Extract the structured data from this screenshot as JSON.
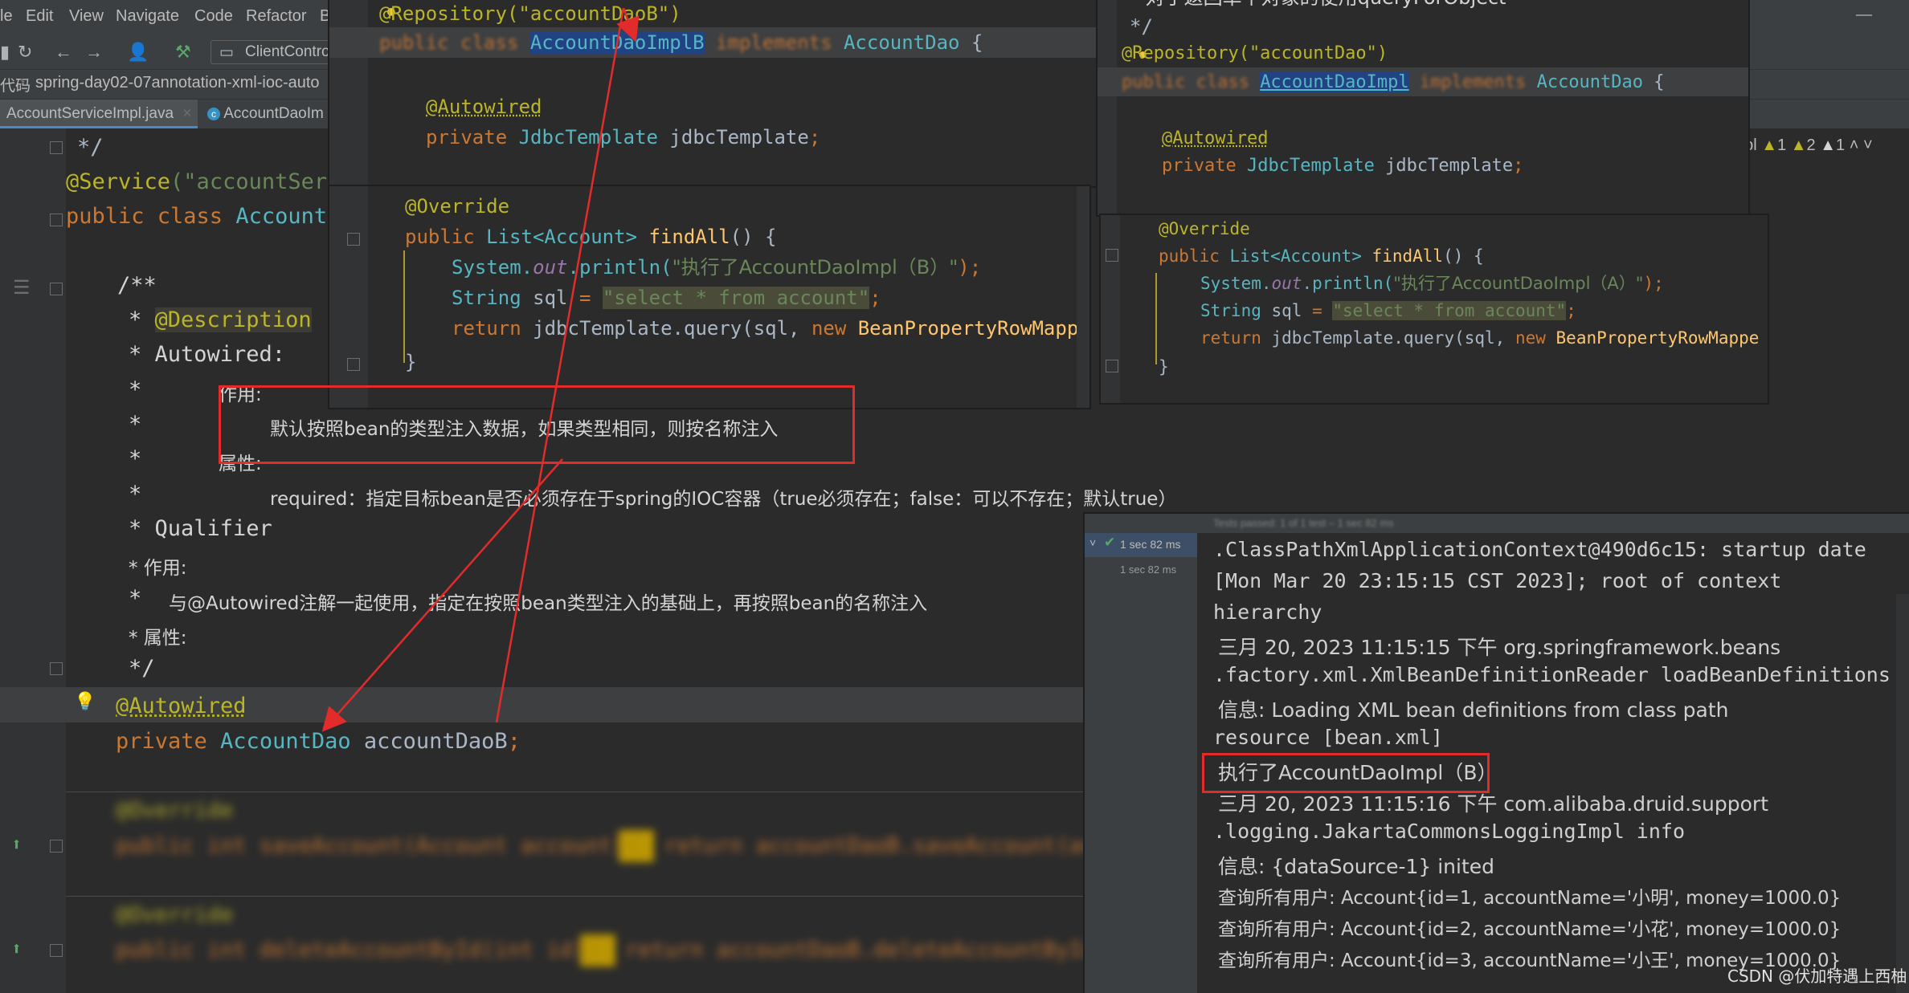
{
  "menu": [
    "le",
    "Edit",
    "View",
    "Navigate",
    "Code",
    "Refactor",
    "B"
  ],
  "toolbar": {
    "run_config": "ClientContro"
  },
  "breadcrumb": {
    "prefix": "代码",
    "project": "spring-day02-07annotation-xml-ioc-auto"
  },
  "tabs": [
    {
      "label": "AccountServiceImpl.java",
      "close": "×"
    },
    {
      "label": "AccountDaoIm"
    }
  ],
  "main_code": {
    "l1": "*/",
    "l2_ann": "@Service",
    "l2_rest": "(\"accountServ",
    "l3_kw": "public class ",
    "l3_cls": "AccountS",
    "doc_open": "/**",
    "doc_desc_star": "* ",
    "doc_desc": "@Description",
    "doc_autowired": "* Autowired:",
    "doc_star": "*",
    "doc_role": "作用:",
    "doc_role_text": "默认按照bean的类型注入数据，如果类型相同，则按名称注入",
    "doc_attr": "属性:",
    "doc_required": "required：指定目标bean是否必须存在于spring的IOC容器（true必须存在；false：可以不存在；默认true）",
    "doc_qualifier": "* Qualifier",
    "doc_q_role": "* 作用:",
    "doc_q_text": "与@Autowired注解一起使用，指定在按照bean类型注入的基础上，再按照bean的名称注入",
    "doc_q_attr": "* 属性:",
    "doc_close": "*/",
    "autowired": "@Autowired",
    "field_kw": "private ",
    "field_type": "AccountDao",
    "field_name": " accountDaoB",
    "field_semi": ";",
    "blur_override1": "@Override",
    "blur_line1": "public int saveAccount(Account account) { return accountDaoB.saveAccount(ac",
    "blur_override2": "@Override",
    "blur_line2": "public int deleteAccountById(int id) { return accountDaoB.deleteAccountById("
  },
  "pane_b": {
    "repo": "@Repository(\"accountDaoB\")",
    "decl_kw": "public class ",
    "decl_cls": "AccountDaoImplB",
    "decl_impl": " implements ",
    "decl_iface": "AccountDao",
    "decl_brace": " {",
    "autowired": "@Autowired",
    "field_kw": "private ",
    "field_type": "JdbcTemplate",
    "field_name": " jdbcTemplate",
    "semi": ";",
    "override": "@Override",
    "m_kw": "public ",
    "m_type": "List<",
    "m_generic": "Account",
    "m_close": "> ",
    "m_name": "findAll",
    "m_rest": "() {",
    "p1": "System.",
    "p_out": "out",
    "p2": ".println(",
    "p_str": "\"执行了AccountDaoImpl（B）\"",
    "p_end": ");",
    "s_type": "String ",
    "s_var": "sql ",
    "s_eq": "= ",
    "s_str": "\"select * from account\"",
    "ret_kw": "return ",
    "ret_rest": "jdbcTemplate.query(sql, ",
    "ret_new": "new ",
    "ret_cls": "BeanPropertyRowMappe",
    "close": "}"
  },
  "pane_a": {
    "top_comment": "* 对于返回单个对象的使用queryForObject",
    "top_close": "*/",
    "repo": "@Repository(\"accountDao\")",
    "decl_kw": "public class ",
    "decl_cls": "AccountDaoImpl",
    "decl_impl": " implements ",
    "decl_iface": "AccountDao",
    "decl_brace": " {",
    "autowired": "@Autowired",
    "field_kw": "private ",
    "field_type": "JdbcTemplate",
    "field_name": " jdbcTemplate",
    "semi": ";",
    "override": "@Override",
    "m_kw": "public ",
    "m_type": "List<",
    "m_generic": "Account",
    "m_close": "> ",
    "m_name": "findAll",
    "m_rest": "() {",
    "p1": "System.",
    "p_out": "out",
    "p2": ".println(",
    "p_str": "\"执行了AccountDaoImpl（A）\"",
    "p_end": ");",
    "s_type": "String ",
    "s_var": "sql ",
    "s_eq": "= ",
    "s_str": "\"select * from account\"",
    "ret_kw": "return ",
    "ret_rest": "jdbcTemplate.query(sql, ",
    "ret_new": "new ",
    "ret_cls": "BeanPropertyRowMappe",
    "close": "}"
  },
  "inspections": {
    "a": "1",
    "b": "2",
    "c": "1",
    "label": "ppl"
  },
  "console": {
    "header": "Tests passed: 1 of 1 test – 1 sec 82 ms",
    "tree1": "1 sec 82 ms",
    "tree2": "1 sec 82 ms",
    "lines": [
      ".ClassPathXmlApplicationContext@490d6c15: startup date",
      "[Mon Mar 20 23:15:15 CST 2023]; root of context",
      "hierarchy",
      "三月 20, 2023 11:15:15 下午 org.springframework.beans",
      ".factory.xml.XmlBeanDefinitionReader loadBeanDefinitions",
      "信息: Loading XML bean definitions from class path",
      "resource [bean.xml]",
      "执行了AccountDaoImpl（B）",
      "三月 20, 2023 11:15:16 下午 com.alibaba.druid.support",
      ".logging.JakartaCommonsLoggingImpl info",
      "信息: {dataSource-1} inited",
      "查询所有用户: Account{id=1, accountName='小明', money=1000.0}",
      "查询所有用户: Account{id=2, accountName='小花', money=1000.0}",
      "查询所有用户: Account{id=3, accountName='小王', money=1000.0}"
    ]
  },
  "watermark": "CSDN @伏加特遇上西柚",
  "colors": {
    "annotation_red": "#e22b2b",
    "accent": "#4a88c7"
  }
}
